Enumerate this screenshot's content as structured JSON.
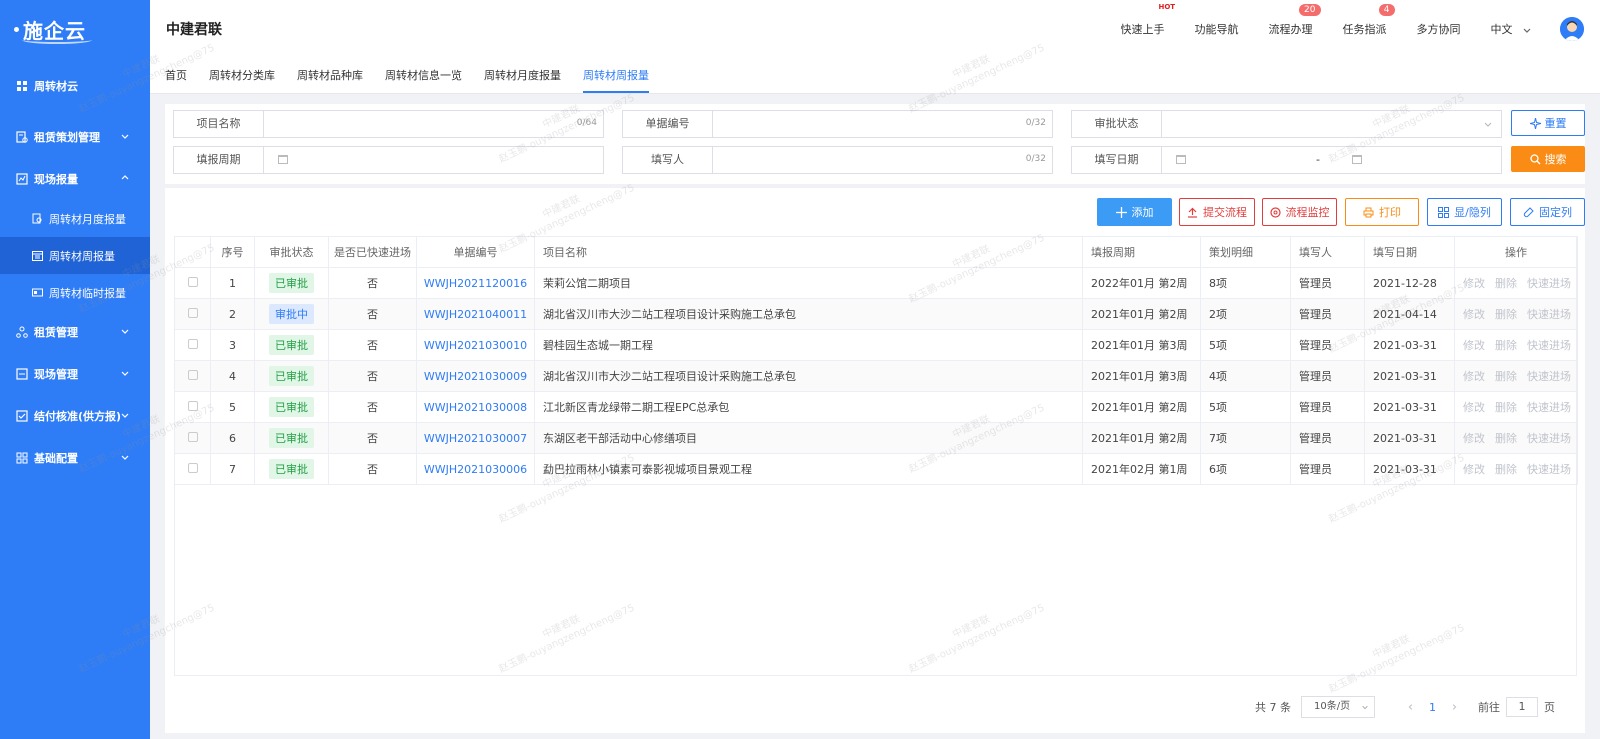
{
  "app": {
    "logo_text": "施企云",
    "company": "中建君联"
  },
  "header": {
    "links": [
      {
        "label": "快速上手",
        "hot": "HOT"
      },
      {
        "label": "功能导航"
      },
      {
        "label": "流程办理",
        "badge": "20"
      },
      {
        "label": "任务指派",
        "badge": "4"
      },
      {
        "label": "多方协同"
      },
      {
        "label": "中文"
      }
    ]
  },
  "sidebar": {
    "items": [
      {
        "label": "周转材云",
        "icon": "grid-icon"
      },
      {
        "label": "租赁策划管理",
        "icon": "plan-icon"
      },
      {
        "label": "现场报量",
        "icon": "report-icon"
      },
      {
        "label": "周转材月度报量",
        "icon": "doc-search-icon"
      },
      {
        "label": "周转材周报量",
        "icon": "calendar-icon"
      },
      {
        "label": "周转材临时报量",
        "icon": "card-icon"
      },
      {
        "label": "租赁管理",
        "icon": "org-icon"
      },
      {
        "label": "现场管理",
        "icon": "site-icon"
      },
      {
        "label": "结付核准(供方报)",
        "icon": "check-icon"
      },
      {
        "label": "基础配置",
        "icon": "apps-icon"
      }
    ]
  },
  "tabs": [
    "首页",
    "周转材分类库",
    "周转材品种库",
    "周转材信息一览",
    "周转材月度报量",
    "周转材周报量"
  ],
  "filter": {
    "project_name": {
      "label": "项目名称",
      "count": "0/64"
    },
    "doc_no": {
      "label": "单据编号",
      "count": "0/32"
    },
    "approval_status": {
      "label": "审批状态"
    },
    "period": {
      "label": "填报周期"
    },
    "filler": {
      "label": "填写人",
      "count": "0/32"
    },
    "fill_date": {
      "label": "填写日期",
      "sep": "-"
    },
    "reset_label": "重置",
    "search_label": "搜索"
  },
  "toolbar": {
    "add": "添加",
    "submit": "提交流程",
    "monitor": "流程监控",
    "print": "打印",
    "toggle_cols": "显/隐列",
    "fix_cols": "固定列"
  },
  "table": {
    "headers": [
      "序号",
      "审批状态",
      "是否已快速进场",
      "单据编号",
      "项目名称",
      "填报周期",
      "策划明细",
      "填写人",
      "填写日期",
      "操作"
    ],
    "ops": [
      "修改",
      "删除",
      "快速进场"
    ],
    "rows": [
      {
        "no": "1",
        "status": "已审批",
        "fast": "否",
        "code": "WWJH2021120016",
        "project": "茉莉公馆二期项目",
        "period": "2022年01月 第2周",
        "detail": "8项",
        "filler": "管理员",
        "date": "2021-12-28"
      },
      {
        "no": "2",
        "status": "审批中",
        "fast": "否",
        "code": "WWJH2021040011",
        "project": "湖北省汉川市大沙二站工程项目设计采购施工总承包",
        "period": "2021年01月 第2周",
        "detail": "2项",
        "filler": "管理员",
        "date": "2021-04-14"
      },
      {
        "no": "3",
        "status": "已审批",
        "fast": "否",
        "code": "WWJH2021030010",
        "project": "碧桂园生态城一期工程",
        "period": "2021年01月 第3周",
        "detail": "5项",
        "filler": "管理员",
        "date": "2021-03-31"
      },
      {
        "no": "4",
        "status": "已审批",
        "fast": "否",
        "code": "WWJH2021030009",
        "project": "湖北省汉川市大沙二站工程项目设计采购施工总承包",
        "period": "2021年01月 第3周",
        "detail": "4项",
        "filler": "管理员",
        "date": "2021-03-31"
      },
      {
        "no": "5",
        "status": "已审批",
        "fast": "否",
        "code": "WWJH2021030008",
        "project": "江北新区青龙绿带二期工程EPC总承包",
        "period": "2021年01月 第2周",
        "detail": "5项",
        "filler": "管理员",
        "date": "2021-03-31"
      },
      {
        "no": "6",
        "status": "已审批",
        "fast": "否",
        "code": "WWJH2021030007",
        "project": "东湖区老干部活动中心修缮项目",
        "period": "2021年01月 第2周",
        "detail": "7项",
        "filler": "管理员",
        "date": "2021-03-31"
      },
      {
        "no": "7",
        "status": "已审批",
        "fast": "否",
        "code": "WWJH2021030006",
        "project": "勐巴拉雨林小镇素可泰影视城项目景观工程",
        "period": "2021年02月 第1周",
        "detail": "6项",
        "filler": "管理员",
        "date": "2021-03-31"
      }
    ]
  },
  "pager": {
    "total": "共 7 条",
    "page_size": "10条/页",
    "current": "1",
    "goto_prefix": "前往",
    "goto_value": "1",
    "goto_suffix": "页"
  },
  "watermark": {
    "line1": "中建君联",
    "line2": "赵玉鹏-ouyangzengcheng@75"
  },
  "colors": {
    "primary": "#2e7cf6",
    "sidebar_active": "#1f63d6",
    "search": "#fa8c16",
    "danger": "#e23d3d",
    "print": "#fa8c16",
    "success": "#22a046"
  }
}
